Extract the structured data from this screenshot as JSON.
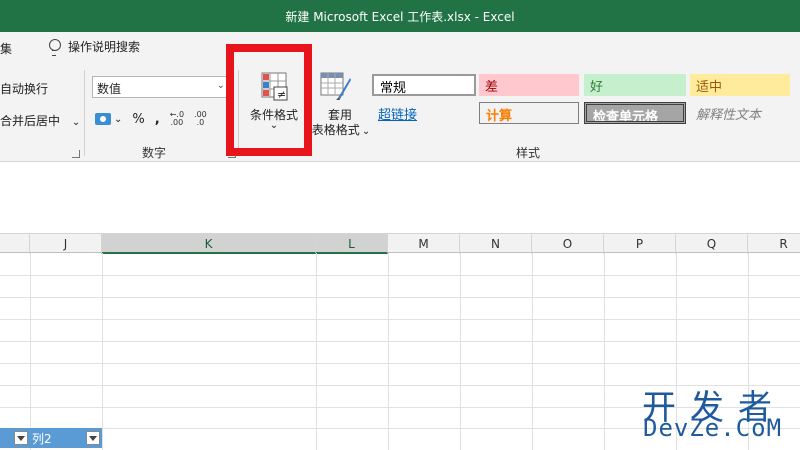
{
  "window": {
    "title": "新建 Microsoft Excel 工作表.xlsx  -  Excel"
  },
  "menu": {
    "tab_fragment": "集",
    "search_label": "操作说明搜索"
  },
  "ribbon": {
    "alignment": {
      "wrap_text": "自动换行",
      "merge_center": "合并后居中"
    },
    "number": {
      "format_value": "数值",
      "percent": "%",
      "comma": ",",
      "increase_decimal": ".00",
      "decrease_decimal": ".0",
      "group_label": "数字"
    },
    "conditional_formatting": {
      "label": "条件格式"
    },
    "format_as_table": {
      "label_line1": "套用",
      "label_line2": "表格格式"
    },
    "styles": {
      "normal": "常规",
      "bad": "差",
      "good": "好",
      "neutral": "适中",
      "hyperlink": "超链接",
      "calculation": "计算",
      "check_cell": "检查单元格",
      "explanatory": "解释性文本",
      "group_label": "样式"
    }
  },
  "grid": {
    "columns": [
      "J",
      "K",
      "L",
      "M",
      "N",
      "O",
      "P",
      "Q",
      "R"
    ],
    "selected_column": "K",
    "filter_header_label": "列2"
  },
  "watermark": {
    "line1": "开发者",
    "line2": "DevZe.CoM"
  }
}
